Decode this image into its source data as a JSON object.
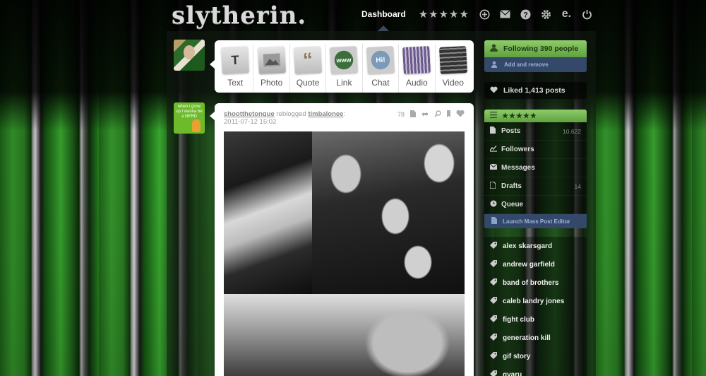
{
  "header": {
    "logo_text": "slytherin.",
    "nav": {
      "dashboard_label": "Dashboard",
      "stars": "★★★★★",
      "icons": [
        "plus-icon",
        "mail-icon",
        "help-icon",
        "gear-icon",
        "e-icon",
        "power-icon"
      ],
      "e_label": "e."
    }
  },
  "post_types": [
    {
      "label": "Text",
      "icon": "T"
    },
    {
      "label": "Photo",
      "icon": ""
    },
    {
      "label": "Quote",
      "icon": "“"
    },
    {
      "label": "Link",
      "icon": "www"
    },
    {
      "label": "Chat",
      "icon": "Hi!"
    },
    {
      "label": "Audio",
      "icon": ""
    },
    {
      "label": "Video",
      "icon": ""
    }
  ],
  "avatar_other_text": "when i grow up i wanna be a NERD",
  "post": {
    "author": "shootthetongue",
    "action": "reblogged",
    "source": "timbalonee",
    "colon": ":",
    "date": "2011-07-12 15:02",
    "notes_count": "78"
  },
  "sidebar": {
    "following_label": "Following 390 people",
    "add_remove_label": "Add and remove",
    "liked_label": "Liked 1,413 posts",
    "blog_title": "★★★★★",
    "blog_items": [
      {
        "label": "Posts",
        "count": "10,622"
      },
      {
        "label": "Followers",
        "count": ""
      },
      {
        "label": "Messages",
        "count": ""
      },
      {
        "label": "Drafts",
        "count": "14"
      },
      {
        "label": "Queue",
        "count": ""
      }
    ],
    "mass_editor_label": "Launch Mass Post Editor",
    "tags": [
      "alex skarsgard",
      "andrew garfield",
      "band of brothers",
      "caleb landry jones",
      "fight club",
      "generation kill",
      "gif story",
      "gyaru"
    ]
  }
}
